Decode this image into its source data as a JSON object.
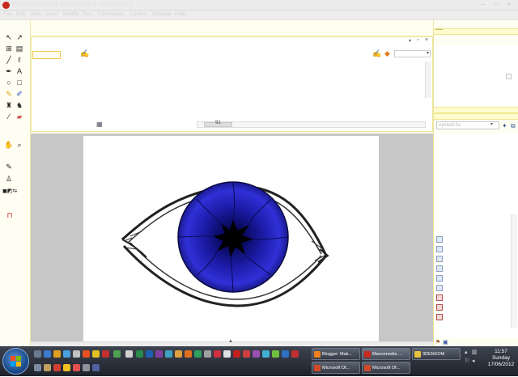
{
  "window": {
    "title": "Macromedia Flash Professional 8 - [eyeball.fla*]"
  },
  "menu": [
    "File",
    "Edit",
    "View",
    "Insert",
    "Modify",
    "Text",
    "Commands",
    "Control",
    "Window",
    "Help"
  ],
  "timeline": {
    "frame_label": "91"
  },
  "library": {
    "select_value": "eyeball.fla"
  },
  "taskbar": {
    "tasks": [
      "Blogger: Mak...",
      "Macromedia ...",
      "3DENXOM",
      "Microsoft Of...",
      "Microsoft Of..."
    ]
  },
  "clock": {
    "time": "11:57",
    "day": "Sunday",
    "date": "17/06/2012"
  },
  "colors": {
    "accent": "#c8281e",
    "iris": "#1c1ca8",
    "stage_bg": "#c7c7c7"
  }
}
